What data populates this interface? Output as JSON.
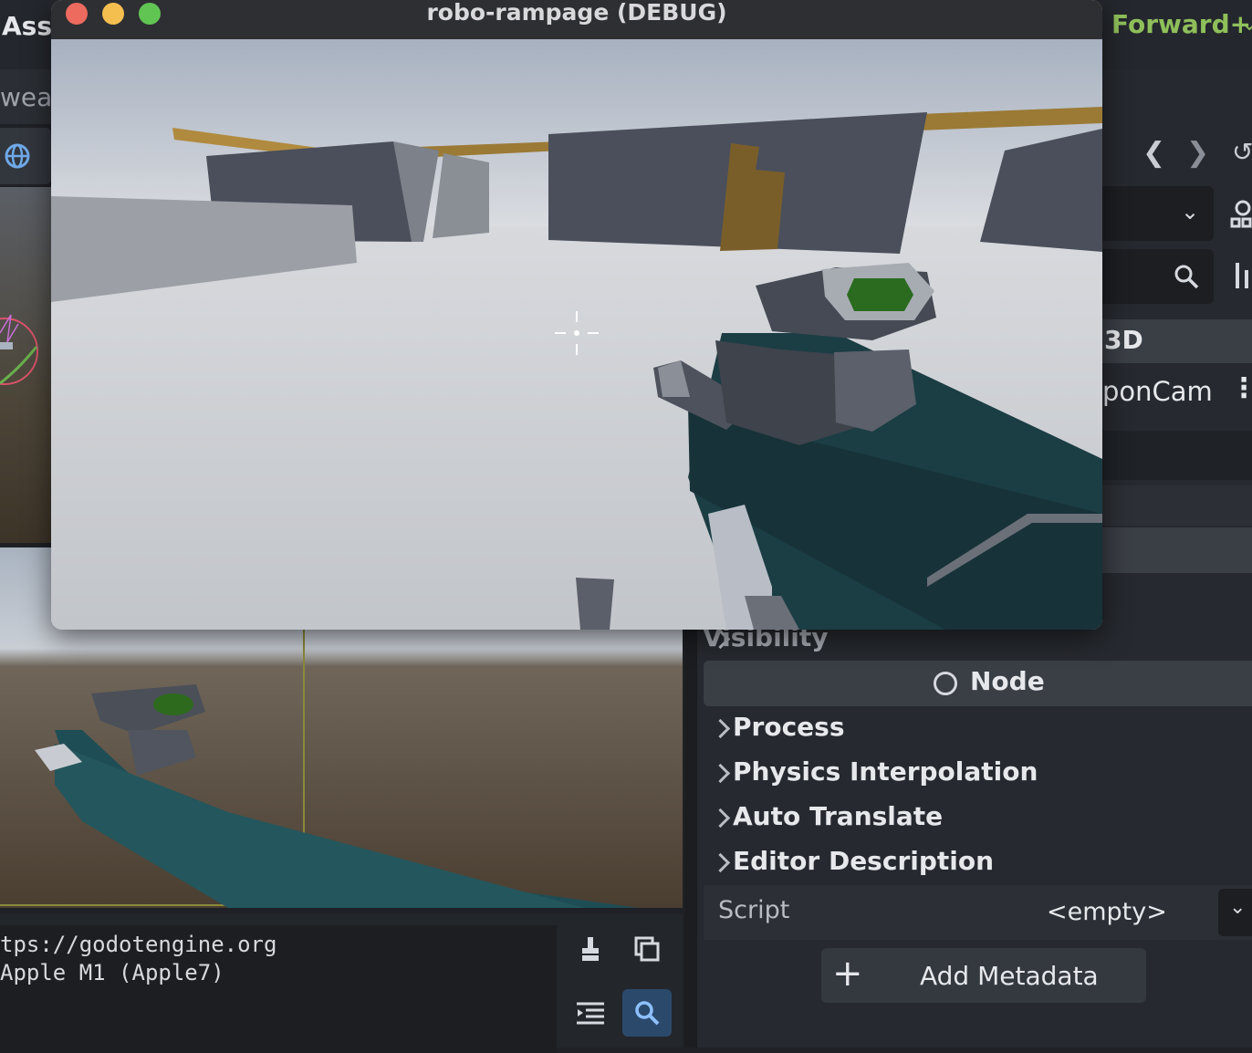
{
  "editor": {
    "top_left_label": "Ass",
    "renderer": "Forward+",
    "scene_tab_partial": "weap",
    "inspector_header_partial": "3D",
    "node_name_partial": "ponCam"
  },
  "inspector": {
    "visibility": "Visibility",
    "node_section": "Node",
    "sections": [
      "Process",
      "Physics Interpolation",
      "Auto Translate",
      "Editor Description"
    ],
    "script_label": "Script",
    "script_value": "<empty>",
    "add_metadata": "Add Metadata"
  },
  "console": {
    "lines": [
      "tps://godotengine.org",
      "Apple M1 (Apple7)"
    ]
  },
  "game_window": {
    "title": "robo-rampage (DEBUG)"
  },
  "colors": {
    "accent": "#8fbf5a",
    "close": "#ed6a5e",
    "minimize": "#f4bf4f",
    "zoom": "#61c554",
    "search_active": "#2b4a6b"
  }
}
